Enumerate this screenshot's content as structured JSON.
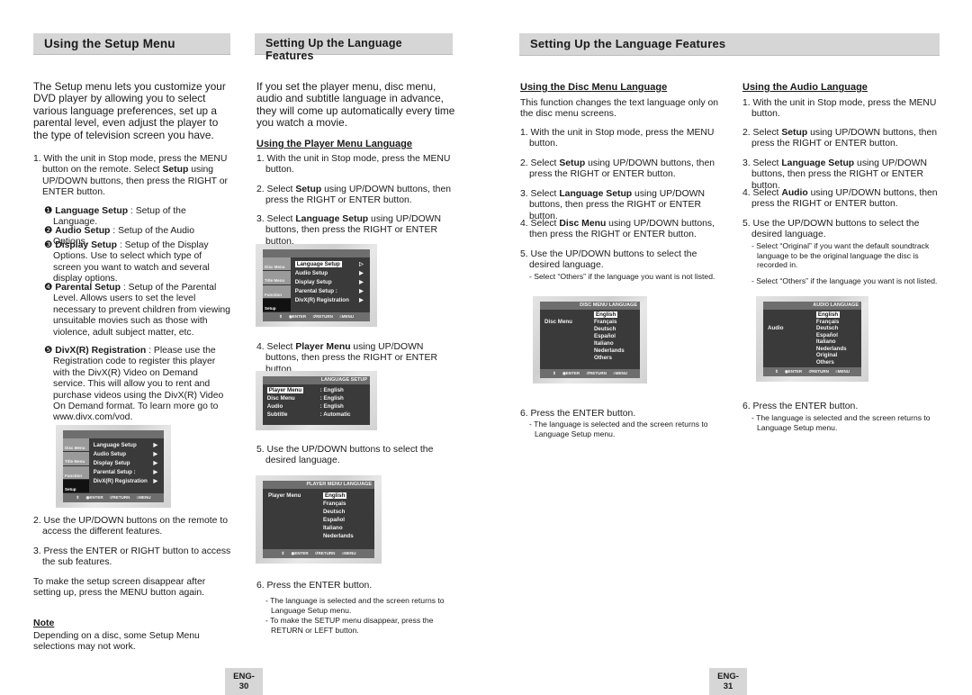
{
  "left": {
    "header": "Using the Setup Menu",
    "intro": "The Setup menu lets you customize your DVD player by allowing you to select various language preferences, set up a parental level, even adjust the player to the type of television screen you have.",
    "step1": {
      "pre": "1. With the unit in Stop mode, press the MENU button on the remote. Select ",
      "bold": "Setup",
      "post": " using UP/DOWN buttons, then press the RIGHT or ENTER button."
    },
    "items": [
      {
        "num": "❶",
        "bold": "Language Setup",
        "text": " : Setup of the Language."
      },
      {
        "num": "❷",
        "bold": "Audio Setup",
        "text": " : Setup of the Audio Options."
      },
      {
        "num": "❸",
        "bold": "Display Setup",
        "text": " : Setup of the Display Options. Use to select which type of screen you want to watch and several display options."
      },
      {
        "num": "❹",
        "bold": "Parental Setup",
        "text": " : Setup of the Parental Level. Allows users to set the level necessary to prevent children from viewing unsuitable movies such as those with violence, adult subject matter, etc."
      },
      {
        "num": "❺",
        "bold": "DivX(R) Registration",
        "text": " : Please use the Registration code to register this player with the DivX(R) Video on Demand service. This will allow you to rent and purchase videos using the DivX(R) Video On Demand format. To learn more go to www.divx.com/vod."
      }
    ],
    "step2": "2. Use the UP/DOWN buttons on the remote to access the different features.",
    "step3": "3. Press the ENTER or RIGHT button to access the sub features.",
    "para": "To make the setup screen disappear after setting up, press the MENU button again.",
    "note_title": "Note",
    "note_text": "Depending on a disc, some Setup Menu selections may not work.",
    "page": "ENG-30"
  },
  "menu": {
    "side": [
      "Disc Menu",
      "Title Menu",
      "Function",
      "Setup"
    ],
    "items": [
      "Language Setup",
      "Audio Setup",
      "Display Setup",
      "Parental Setup :",
      "DivX(R) Registration"
    ],
    "footer": "⇕ ◉ENTER ↺RETURN ≡MENU"
  },
  "langsetup": {
    "title": "LANGUAGE SETUP",
    "rows": [
      {
        "k": "Player Menu",
        "v": ": English"
      },
      {
        "k": "Disc Menu",
        "v": ": English"
      },
      {
        "k": "Audio",
        "v": ": English"
      },
      {
        "k": "Subtitle",
        "v": ": Automatic"
      }
    ]
  },
  "middle": {
    "header": "Setting Up the Language Features",
    "intro": "If you set the player menu, disc menu, audio and subtitle language in advance, they will come up automatically every time you watch a movie.",
    "sub": "Using the Player Menu Language",
    "step1": "1. With the unit in Stop mode, press the MENU button.",
    "step2": {
      "pre": "2. Select ",
      "bold": "Setup",
      "post": " using UP/DOWN buttons, then press the RIGHT or ENTER button."
    },
    "step3": {
      "pre": "3. Select ",
      "bold": "Language Setup",
      "post": " using UP/DOWN buttons, then press the RIGHT or ENTER button."
    },
    "step4": {
      "pre": "4. Select ",
      "bold": "Player Menu",
      "post": " using UP/DOWN buttons, then press the RIGHT or ENTER button."
    },
    "step5": "5. Use the UP/DOWN buttons to select the desired language.",
    "screen": {
      "title": "PLAYER MENU LANGUAGE",
      "label": "Player Menu",
      "langs": [
        "English",
        "Français",
        "Deutsch",
        "Español",
        "Italiano",
        "Nederlands"
      ]
    },
    "step6": "6. Press the ENTER button.",
    "notes": [
      "- The language is selected and the screen returns to Language Setup menu.",
      "- To make the SETUP menu disappear, press the RETURN or LEFT button."
    ]
  },
  "right": {
    "header": "Setting Up the Language Features",
    "disc": {
      "sub": "Using the Disc Menu Language",
      "intro": "This function changes the text language only on the disc menu screens.",
      "step1": "1. With the unit in Stop mode, press the MENU button.",
      "step2": {
        "pre": "2. Select ",
        "bold": "Setup",
        "post": " using UP/DOWN buttons, then press the RIGHT or ENTER button."
      },
      "step3": {
        "pre": "3. Select ",
        "bold": "Language Setup",
        "post": " using UP/DOWN buttons, then press the RIGHT or ENTER button."
      },
      "step4": {
        "pre": "4. Select ",
        "bold": "Disc Menu",
        "post": " using UP/DOWN buttons, then press the RIGHT or ENTER button."
      },
      "step5": "5. Use the UP/DOWN buttons to select the desired language.",
      "note5": "- Select “Others” if the language you want is not listed.",
      "screen": {
        "title": "DISC MENU LANGUAGE",
        "label": "Disc Menu",
        "langs": [
          "English",
          "Français",
          "Deutsch",
          "Español",
          "Italiano",
          "Nederlands",
          "Others"
        ]
      },
      "step6": "6. Press the ENTER button.",
      "note6": "- The language is selected and the screen returns to Language Setup menu."
    },
    "audio": {
      "sub": "Using the Audio Language",
      "step1": "1. With the unit in Stop mode, press the MENU button.",
      "step2": {
        "pre": "2. Select ",
        "bold": "Setup",
        "post": " using UP/DOWN buttons, then press the RIGHT or ENTER button."
      },
      "step3": {
        "pre": "3. Select ",
        "bold": "Language Setup",
        "post": " using UP/DOWN buttons, then press the RIGHT or ENTER button."
      },
      "step4": {
        "pre": "4. Select ",
        "bold": "Audio",
        "post": " using UP/DOWN buttons, then press the RIGHT or ENTER button."
      },
      "step5": "5. Use the UP/DOWN buttons to select the desired language.",
      "note5a": "- Select “Original” if you want the default soundtrack language to be the original language the disc is recorded in.",
      "note5b": "- Select “Others” if the language you want is not listed.",
      "screen": {
        "title": "AUDIO LANGUAGE",
        "label": "Audio",
        "langs": [
          "English",
          "Français",
          "Deutsch",
          "Español",
          "Italiano",
          "Nederlands",
          "Original",
          "Others"
        ]
      },
      "step6": "6. Press the ENTER button.",
      "note6": "- The language is selected and the screen returns to Language Setup menu."
    },
    "page": "ENG-31"
  }
}
